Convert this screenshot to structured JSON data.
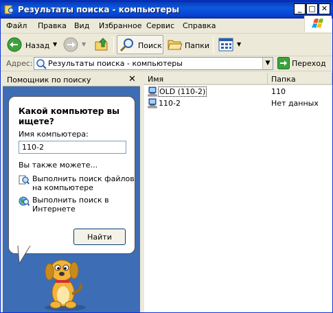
{
  "window": {
    "title": "Результаты поиска - компьютеры",
    "controls": [
      "_",
      "□",
      "✕"
    ]
  },
  "menu": {
    "items": [
      {
        "label": "Файл"
      },
      {
        "label": "Правка"
      },
      {
        "label": "Вид"
      },
      {
        "label": "Избранное"
      },
      {
        "label": "Сервис"
      },
      {
        "label": "Справка"
      }
    ]
  },
  "toolbar": {
    "back_label": "Назад",
    "search_label": "Поиск",
    "folders_label": "Папки"
  },
  "address": {
    "label": "Адрес:",
    "value": "Результаты поиска - компьютеры",
    "go_label": "Переход"
  },
  "search_pane": {
    "title": "Помощник по поиску",
    "question": "Какой компьютер вы ищете?",
    "field_label": "Имя компьютера:",
    "field_value": "110-2",
    "also_label": "Вы также можете...",
    "options": [
      {
        "label": "Выполнить поиск файлов на компьютере",
        "icon": "search-files-icon"
      },
      {
        "label": "Выполнить поиск в Интернете",
        "icon": "search-internet-icon"
      }
    ],
    "find_button": "Найти"
  },
  "results": {
    "columns": [
      "Имя",
      "Папка"
    ],
    "rows": [
      {
        "name": "OLD (110-2)",
        "folder": "110",
        "icon": "computer-icon"
      },
      {
        "name": "110-2",
        "folder": "Нет данных",
        "icon": "computer-icon"
      }
    ]
  },
  "colors": {
    "titlebar": "#0A5AE0",
    "pane_background": "#3D6DB5",
    "window_face": "#ECE9D8"
  }
}
